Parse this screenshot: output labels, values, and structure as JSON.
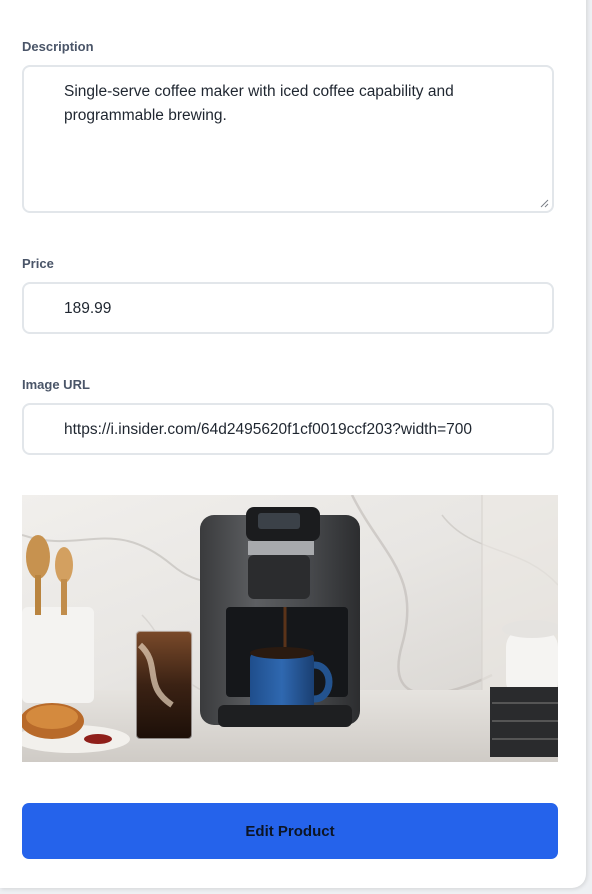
{
  "form": {
    "description": {
      "label": "Description",
      "value_line1": "Single-serve coffee maker with iced coffee capability and",
      "value_line2": "programmable brewing."
    },
    "price": {
      "label": "Price",
      "value": "189.99"
    },
    "image_url": {
      "label": "Image URL",
      "value": "https://i.insider.com/64d2495620f1cf0019ccf203?width=700"
    },
    "preview": {
      "alt": "Coffee maker product image"
    },
    "submit_label": "Edit Product"
  },
  "colors": {
    "accent": "#2563eb",
    "label": "#4a5568",
    "field_border": "#e2e6ea"
  }
}
